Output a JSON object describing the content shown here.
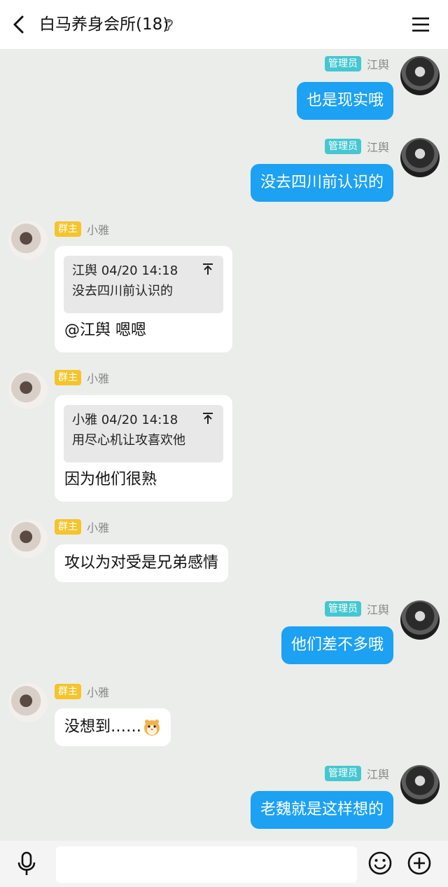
{
  "header": {
    "title": "白马养身会所(18)"
  },
  "roles": {
    "admin": "管理员",
    "owner": "群主"
  },
  "users": {
    "me": "江舆",
    "other": "小雅"
  },
  "messages": [
    {
      "text": "也是现实哦"
    },
    {
      "text": "没去四川前认识的"
    },
    {
      "quote_head": "江舆 04/20 14:18",
      "quote_text": "没去四川前认识的",
      "text": "@江舆 嗯嗯"
    },
    {
      "quote_head": "小雅 04/20 14:18",
      "quote_text": "用尽心机让攻喜欢他",
      "text": "因为他们很熟"
    },
    {
      "text": "攻以为对受是兄弟感情"
    },
    {
      "text": "他们差不多哦"
    },
    {
      "text": "没想到……"
    },
    {
      "text": "老魏就是这样想的"
    }
  ],
  "input": {
    "placeholder": ""
  }
}
